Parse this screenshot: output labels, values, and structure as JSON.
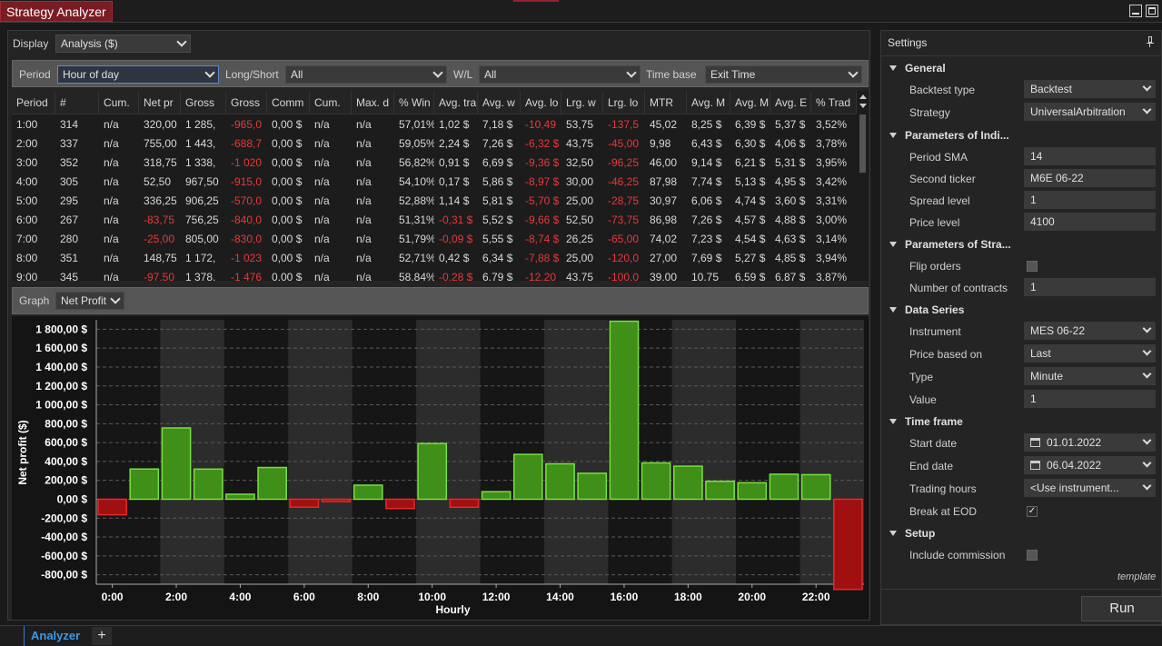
{
  "window": {
    "title": "Strategy Analyzer"
  },
  "display": {
    "label": "Display",
    "value": "Analysis ($)"
  },
  "filters": {
    "period_label": "Period",
    "period_value": "Hour of day",
    "longshort_label": "Long/Short",
    "longshort_value": "All",
    "wl_label": "W/L",
    "wl_value": "All",
    "timebase_label": "Time base",
    "timebase_value": "Exit Time"
  },
  "table": {
    "headers": [
      "Period",
      "#",
      "Cum.",
      "Net pr",
      "Gross",
      "Gross",
      "Comm",
      "Cum.",
      "Max. d",
      "% Win",
      "Avg. tra",
      "Avg. w",
      "Avg. lo",
      "Lrg. w",
      "Lrg. lo",
      "MTR",
      "Avg. M",
      "Avg. M",
      "Avg. E",
      "% Trad"
    ],
    "rows": [
      [
        "1:00",
        "314",
        "n/a",
        "320,00",
        "1 285,",
        "-965,0",
        "0,00 $",
        "n/a",
        "n/a",
        "57,01%",
        "1,02 $",
        "7,18 $",
        "-10,49",
        "53,75",
        "-137,5",
        "45,02",
        "8,25 $",
        "6,39 $",
        "5,37 $",
        "3,52%"
      ],
      [
        "2:00",
        "337",
        "n/a",
        "755,00",
        "1 443,",
        "-688,7",
        "0,00 $",
        "n/a",
        "n/a",
        "59,05%",
        "2,24 $",
        "7,26 $",
        "-6,32 $",
        "43,75",
        "-45,00",
        "9,98",
        "6,43 $",
        "6,30 $",
        "4,06 $",
        "3,78%"
      ],
      [
        "3:00",
        "352",
        "n/a",
        "318,75",
        "1 338,",
        "-1 020",
        "0,00 $",
        "n/a",
        "n/a",
        "56,82%",
        "0,91 $",
        "6,69 $",
        "-9,36 $",
        "32,50",
        "-96,25",
        "46,00",
        "9,14 $",
        "6,21 $",
        "5,31 $",
        "3,95%"
      ],
      [
        "4:00",
        "305",
        "n/a",
        "52,50",
        "967,50",
        "-915,0",
        "0,00 $",
        "n/a",
        "n/a",
        "54,10%",
        "0,17 $",
        "5,86 $",
        "-8,97 $",
        "30,00",
        "-46,25",
        "87,98",
        "7,74 $",
        "5,13 $",
        "4,95 $",
        "3,42%"
      ],
      [
        "5:00",
        "295",
        "n/a",
        "336,25",
        "906,25",
        "-570,0",
        "0,00 $",
        "n/a",
        "n/a",
        "52,88%",
        "1,14 $",
        "5,81 $",
        "-5,70 $",
        "25,00",
        "-28,75",
        "30,97",
        "6,06 $",
        "4,74 $",
        "3,60 $",
        "3,31%"
      ],
      [
        "6:00",
        "267",
        "n/a",
        "-83,75",
        "756,25",
        "-840,0",
        "0,00 $",
        "n/a",
        "n/a",
        "51,31%",
        "-0,31 $",
        "5,52 $",
        "-9,66 $",
        "52,50",
        "-73,75",
        "86,98",
        "7,26 $",
        "4,57 $",
        "4,88 $",
        "3,00%"
      ],
      [
        "7:00",
        "280",
        "n/a",
        "-25,00",
        "805,00",
        "-830,0",
        "0,00 $",
        "n/a",
        "n/a",
        "51,79%",
        "-0,09 $",
        "5,55 $",
        "-8,74 $",
        "26,25",
        "-65,00",
        "74,02",
        "7,23 $",
        "4,54 $",
        "4,63 $",
        "3,14%"
      ],
      [
        "8:00",
        "351",
        "n/a",
        "148,75",
        "1 172,",
        "-1 023",
        "0,00 $",
        "n/a",
        "n/a",
        "52,71%",
        "0,42 $",
        "6,34 $",
        "-7,88 $",
        "25,00",
        "-120,0",
        "27,00",
        "7,69 $",
        "5,27 $",
        "4,85 $",
        "3,94%"
      ],
      [
        "9:00",
        "345",
        "n/a",
        "-97,50",
        "1 378,",
        "-1 476",
        "0,00 $",
        "n/a",
        "n/a",
        "58,84%",
        "-0,28 $",
        "6,79 $",
        "-12,20",
        "43,75",
        "-100,0",
        "39,00",
        "10,75",
        "6,59 $",
        "6,87 $",
        "3,87%"
      ]
    ]
  },
  "graph": {
    "label": "Graph",
    "value": "Net Profit"
  },
  "chart_data": {
    "type": "bar",
    "xlabel": "Hourly",
    "ylabel": "Net profit ($)",
    "ylim": [
      -900,
      1900
    ],
    "yticks": [
      "1 800,00 $",
      "1 600,00 $",
      "1 400,00 $",
      "1 200,00 $",
      "1 000,00 $",
      "800,00 $",
      "600,00 $",
      "400,00 $",
      "200,00 $",
      "0,00 $",
      "-200,00 $",
      "-400,00 $",
      "-600,00 $",
      "-800,00 $"
    ],
    "ytick_values": [
      1800,
      1600,
      1400,
      1200,
      1000,
      800,
      600,
      400,
      200,
      0,
      -200,
      -400,
      -600,
      -800
    ],
    "xticks": [
      "0:00",
      "2:00",
      "4:00",
      "6:00",
      "8:00",
      "10:00",
      "12:00",
      "14:00",
      "16:00",
      "18:00",
      "20:00",
      "22:00"
    ],
    "categories": [
      "0:00",
      "1:00",
      "2:00",
      "3:00",
      "4:00",
      "5:00",
      "6:00",
      "7:00",
      "8:00",
      "9:00",
      "10:00",
      "11:00",
      "12:00",
      "13:00",
      "14:00",
      "15:00",
      "16:00",
      "17:00",
      "18:00",
      "19:00",
      "20:00",
      "21:00",
      "22:00",
      "23:00"
    ],
    "values": [
      -165,
      320,
      755,
      319,
      53,
      336,
      -84,
      -25,
      149,
      -98,
      590,
      -85,
      80,
      475,
      375,
      275,
      1885,
      385,
      350,
      190,
      175,
      265,
      260,
      -955
    ],
    "grid": true,
    "colors": {
      "positive": "#4caf1e",
      "negative": "#b81414"
    }
  },
  "settings": {
    "title": "Settings",
    "template_label": "template",
    "run_label": "Run",
    "sections": [
      {
        "name": "General",
        "props": [
          {
            "label": "Backtest type",
            "value": "Backtest",
            "kind": "select"
          },
          {
            "label": "Strategy",
            "value": "UniversalArbitration",
            "kind": "select"
          }
        ]
      },
      {
        "name": "Parameters of Indi...",
        "props": [
          {
            "label": "Period SMA",
            "value": "14",
            "kind": "text"
          },
          {
            "label": "Second ticker",
            "value": "M6E 06-22",
            "kind": "text"
          },
          {
            "label": "Spread level",
            "value": "1",
            "kind": "text"
          },
          {
            "label": "Price level",
            "value": "4100",
            "kind": "text"
          }
        ]
      },
      {
        "name": "Parameters of Stra...",
        "props": [
          {
            "label": "Flip orders",
            "value": "",
            "kind": "check"
          },
          {
            "label": "Number of contracts",
            "value": "1",
            "kind": "text"
          }
        ]
      },
      {
        "name": "Data Series",
        "props": [
          {
            "label": "Instrument",
            "value": "MES 06-22",
            "kind": "select"
          },
          {
            "label": "Price based on",
            "value": "Last",
            "kind": "select"
          },
          {
            "label": "Type",
            "value": "Minute",
            "kind": "select"
          },
          {
            "label": "Value",
            "value": "1",
            "kind": "text"
          }
        ]
      },
      {
        "name": "Time frame",
        "props": [
          {
            "label": "Start date",
            "value": "01.01.2022",
            "kind": "date"
          },
          {
            "label": "End date",
            "value": "06.04.2022",
            "kind": "date"
          },
          {
            "label": "Trading hours",
            "value": "<Use instrument...",
            "kind": "select"
          },
          {
            "label": "Break at EOD",
            "value": "✓",
            "kind": "checked"
          }
        ]
      },
      {
        "name": "Setup",
        "props": [
          {
            "label": "Include commission",
            "value": "",
            "kind": "check"
          }
        ]
      }
    ]
  },
  "tabs": {
    "active": "Analyzer",
    "add": "+"
  }
}
